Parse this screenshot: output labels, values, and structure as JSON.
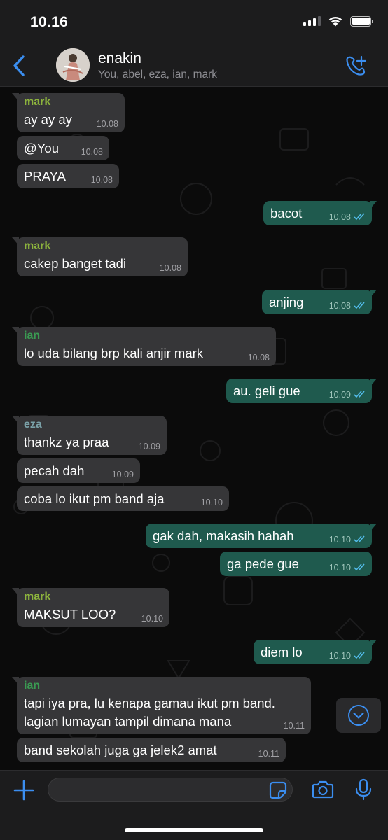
{
  "status_bar": {
    "time": "10.16"
  },
  "header": {
    "title": "enakin",
    "members": "You, abel, eza, ian, mark"
  },
  "colors": {
    "accent": "#3b8ef0",
    "outgoing_bubble": "#1f5a4e",
    "incoming_bubble": "#363638",
    "sender_mark": "#8db43d",
    "sender_ian": "#3a9b52",
    "sender_eza": "#7aa1a8"
  },
  "messages": [
    {
      "sender": "mark",
      "text": "ay ay ay",
      "time": "10.08"
    },
    {
      "text": "@You",
      "time": "10.08"
    },
    {
      "text": "PRAYA",
      "time": "10.08"
    },
    {
      "text": "bacot",
      "time": "10.08"
    },
    {
      "sender": "mark",
      "text": "cakep banget tadi",
      "time": "10.08"
    },
    {
      "text": "anjing",
      "time": "10.08"
    },
    {
      "sender": "ian",
      "text": "lo uda bilang brp kali anjir mark",
      "time": "10.08"
    },
    {
      "text": "au. geli gue",
      "time": "10.09"
    },
    {
      "sender": "eza",
      "text": "thankz ya praa",
      "time": "10.09"
    },
    {
      "text": "pecah dah",
      "time": "10.09"
    },
    {
      "text": "coba lo ikut pm band aja",
      "time": "10.10"
    },
    {
      "text": "gak dah, makasih hahah",
      "time": "10.10"
    },
    {
      "text": "ga pede gue",
      "time": "10.10"
    },
    {
      "sender": "mark",
      "text": "MAKSUT LOO?",
      "time": "10.10"
    },
    {
      "text": "diem lo",
      "time": "10.10"
    },
    {
      "sender": "ian",
      "text_line1": "tapi iya pra, lu kenapa gamau ikut pm band.",
      "text_line2": "lagian lumayan tampil dimana mana",
      "time": "10.11"
    },
    {
      "text": "band sekolah juga ga jelek2 amat",
      "time": "10.11"
    }
  ],
  "input": {
    "value": "",
    "placeholder": ""
  },
  "icons": {
    "back": "chevron-left-icon",
    "call": "add-call-icon",
    "scroll_down": "chevron-down-icon",
    "plus": "plus-icon",
    "sticker": "sticker-icon",
    "camera": "camera-icon",
    "mic": "microphone-icon",
    "read_receipt": "double-check-icon"
  }
}
